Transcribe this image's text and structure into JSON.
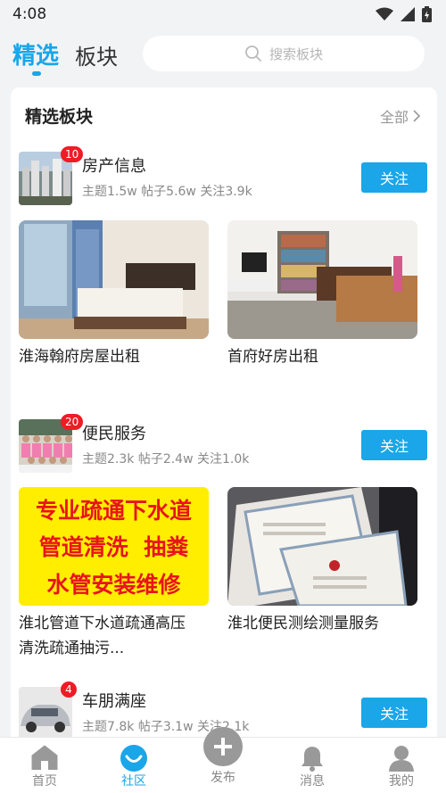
{
  "status": {
    "time": "4:08"
  },
  "tabs": {
    "featured": "精选",
    "board": "板块"
  },
  "search": {
    "placeholder": "搜索板块"
  },
  "card": {
    "title": "精选板块",
    "all_label": "全部"
  },
  "sections": [
    {
      "name": "房产信息",
      "badge": "10",
      "stats": "主题1.5w   帖子5.6w   关注3.9k",
      "follow_label": "关注",
      "posts": [
        {
          "title_lines": [
            "淮海翰府房屋出租"
          ]
        },
        {
          "title_lines": [
            "首府好房出租"
          ]
        }
      ]
    },
    {
      "name": "便民服务",
      "badge": "20",
      "stats": "主题2.3k   帖子2.4w   关注1.0k",
      "follow_label": "关注",
      "posts": [
        {
          "ad_lines": [
            "专业疏通下水道",
            "管道清洗  抽粪",
            "水管安装维修"
          ],
          "title_lines": [
            "淮北管道下水道疏通高压",
            "清洗疏通抽污..."
          ]
        },
        {
          "title_lines": [
            "淮北便民测绘测量服务"
          ]
        }
      ]
    },
    {
      "name": "车朋满座",
      "badge": "4",
      "stats": "主题7.8k   帖子3.1w   关注2.1k",
      "follow_label": "关注"
    }
  ],
  "nav": [
    {
      "label": "首页",
      "icon": "home-icon"
    },
    {
      "label": "社区",
      "icon": "community-icon"
    },
    {
      "label": "发布",
      "icon": "publish-icon"
    },
    {
      "label": "消息",
      "icon": "bell-icon"
    },
    {
      "label": "我的",
      "icon": "profile-icon"
    }
  ],
  "colors": {
    "accent": "#1aa6e8",
    "badge": "#ee1c25",
    "ad_yellow": "#ffee00",
    "ad_red": "#e8141c"
  }
}
